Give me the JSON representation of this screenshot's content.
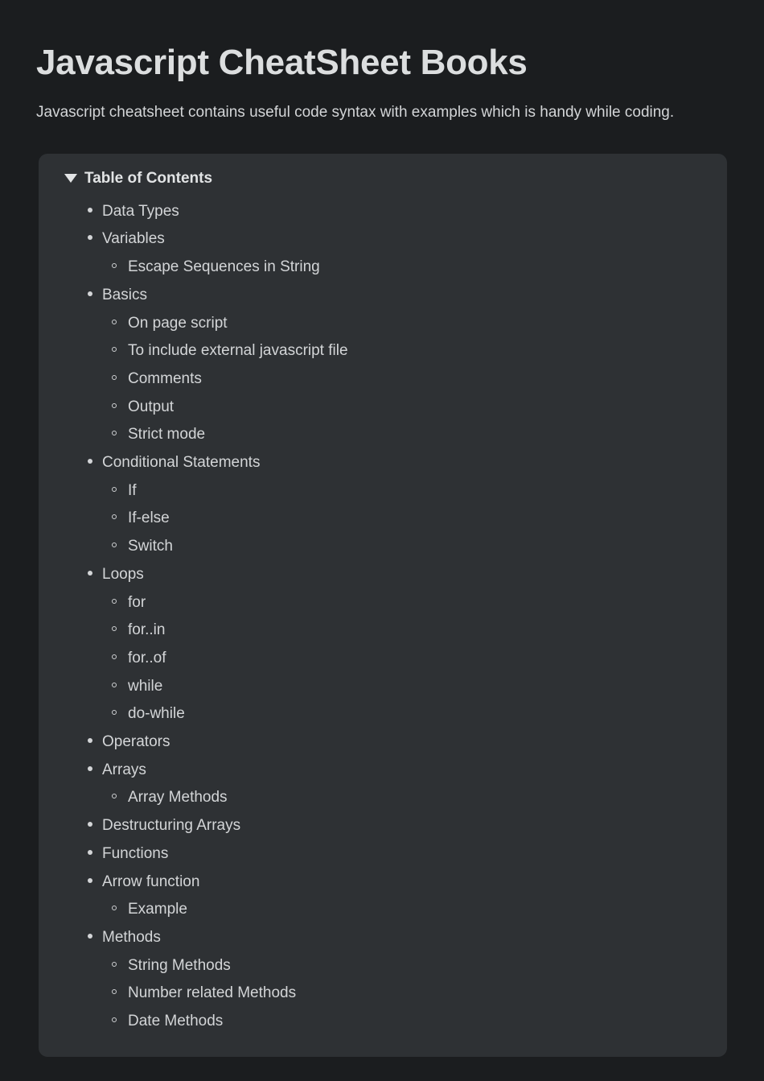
{
  "page": {
    "title": "Javascript CheatSheet Books",
    "description": "Javascript cheatsheet contains useful code syntax with examples which is handy while coding."
  },
  "toc": {
    "summary_label": "Table of Contents",
    "marker_icon": "triangle-down-icon",
    "expanded": true,
    "bullet_level1_icon": "disc-bullet-icon",
    "bullet_level2_icon": "circle-bullet-icon",
    "items": [
      {
        "label": "Data Types",
        "children": []
      },
      {
        "label": "Variables",
        "children": [
          {
            "label": "Escape Sequences in String"
          }
        ]
      },
      {
        "label": "Basics",
        "children": [
          {
            "label": "On page script"
          },
          {
            "label": "To include external javascript file"
          },
          {
            "label": "Comments"
          },
          {
            "label": "Output"
          },
          {
            "label": "Strict mode"
          }
        ]
      },
      {
        "label": "Conditional Statements",
        "children": [
          {
            "label": "If"
          },
          {
            "label": "If-else"
          },
          {
            "label": "Switch"
          }
        ]
      },
      {
        "label": "Loops",
        "children": [
          {
            "label": "for"
          },
          {
            "label": "for..in"
          },
          {
            "label": "for..of"
          },
          {
            "label": "while"
          },
          {
            "label": "do-while"
          }
        ]
      },
      {
        "label": "Operators",
        "children": []
      },
      {
        "label": "Arrays",
        "children": [
          {
            "label": "Array Methods"
          }
        ]
      },
      {
        "label": "Destructuring Arrays",
        "children": []
      },
      {
        "label": "Functions",
        "children": []
      },
      {
        "label": "Arrow function",
        "children": [
          {
            "label": "Example"
          }
        ]
      },
      {
        "label": "Methods",
        "children": [
          {
            "label": "String Methods"
          },
          {
            "label": "Number related Methods"
          },
          {
            "label": "Date Methods"
          }
        ]
      }
    ]
  },
  "colors": {
    "background": "#1b1d1f",
    "panel_background": "#2e3134",
    "title_text": "#dcdedf",
    "body_text": "#d3d5d7"
  }
}
